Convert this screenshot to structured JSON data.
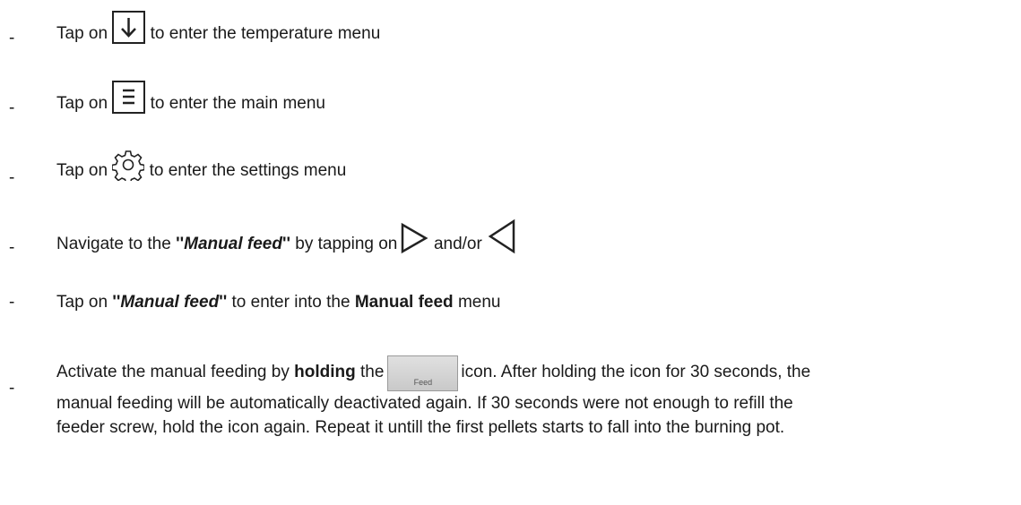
{
  "bullet": "-",
  "step1": {
    "prefix": "Tap on",
    "icon": "arrow-down-icon",
    "suffix": "to enter the temperature menu"
  },
  "step2": {
    "prefix": "Tap on",
    "icon": "menu-icon",
    "suffix": "to enter the main menu"
  },
  "step3": {
    "prefix": "Tap on",
    "icon": "gear-icon",
    "suffix": "to enter the settings menu"
  },
  "step4": {
    "prefix": "Navigate to the",
    "quote_open": "''",
    "term": "Manual feed",
    "quote_close": "''",
    "middle": "by tapping on",
    "icon_next": "triangle-right-icon",
    "andor": "and/or",
    "icon_prev": "triangle-left-icon"
  },
  "step5": {
    "prefix": "Tap on",
    "quote_open": "''",
    "term": "Manual feed",
    "quote_close": "''",
    "middle": "to enter into the",
    "menu_name": "Manual feed",
    "suffix": "menu"
  },
  "step6": {
    "prefix": "Activate the manual feeding by",
    "bold": "holding",
    "the": "the",
    "button_label": "Feed",
    "after_icon": "icon. After holding the icon for 30 seconds, the",
    "line2": "manual feeding will be automatically deactivated again. If 30 seconds were not enough to refill the",
    "line3": "feeder screw, hold the icon again. Repeat it untill the first pellets starts to fall into the burning pot."
  }
}
